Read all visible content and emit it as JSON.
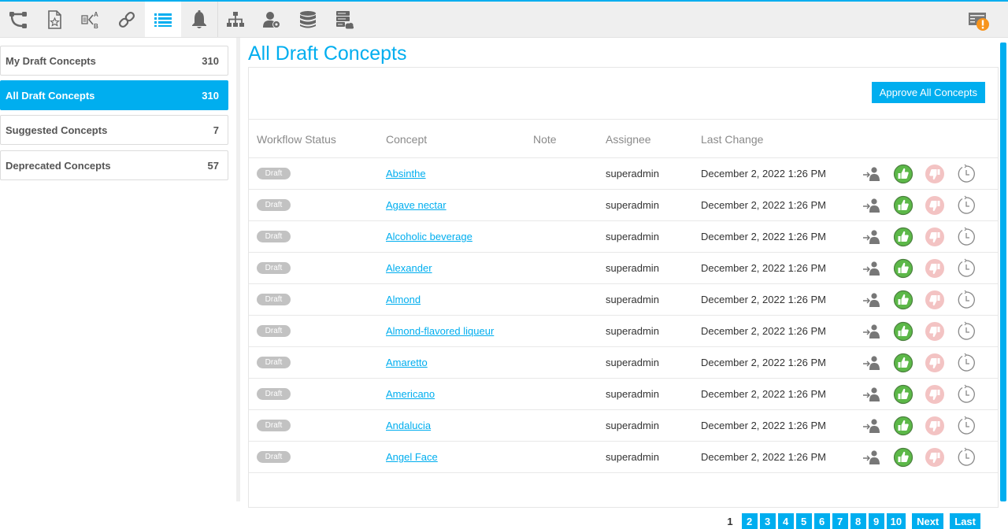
{
  "toolbar": {
    "tools": [
      {
        "name": "workflow-icon",
        "active": false
      },
      {
        "name": "favorite-document-icon",
        "active": false
      },
      {
        "name": "compare-ab-icon",
        "active": false
      },
      {
        "name": "link-icon",
        "active": false
      },
      {
        "name": "list-icon",
        "active": true
      },
      {
        "name": "bell-icon",
        "active": false
      },
      {
        "name": "hierarchy-icon",
        "active": false
      },
      {
        "name": "user-settings-icon",
        "active": false
      },
      {
        "name": "database-icon",
        "active": false
      },
      {
        "name": "server-cloud-icon",
        "active": false
      }
    ],
    "alert_icon": "task-alert-icon",
    "accent_color": "#00aeef",
    "alert_color": "#f7941d"
  },
  "sidebar": {
    "items": [
      {
        "label": "My Draft Concepts",
        "count": "310",
        "active": false
      },
      {
        "label": "All Draft Concepts",
        "count": "310",
        "active": true
      },
      {
        "label": "Suggested Concepts",
        "count": "7",
        "active": false
      },
      {
        "label": "Deprecated Concepts",
        "count": "57",
        "active": false
      }
    ]
  },
  "main": {
    "title": "All Draft Concepts",
    "approve_all_label": "Approve All Concepts",
    "columns": [
      "Workflow Status",
      "Concept",
      "Note",
      "Assignee",
      "Last Change"
    ],
    "rows": [
      {
        "status": "Draft",
        "concept": "Absinthe",
        "note": "",
        "assignee": "superadmin",
        "last_change": "December 2, 2022 1:26 PM"
      },
      {
        "status": "Draft",
        "concept": "Agave nectar",
        "note": "",
        "assignee": "superadmin",
        "last_change": "December 2, 2022 1:26 PM"
      },
      {
        "status": "Draft",
        "concept": "Alcoholic beverage",
        "note": "",
        "assignee": "superadmin",
        "last_change": "December 2, 2022 1:26 PM"
      },
      {
        "status": "Draft",
        "concept": "Alexander",
        "note": "",
        "assignee": "superadmin",
        "last_change": "December 2, 2022 1:26 PM"
      },
      {
        "status": "Draft",
        "concept": "Almond",
        "note": "",
        "assignee": "superadmin",
        "last_change": "December 2, 2022 1:26 PM"
      },
      {
        "status": "Draft",
        "concept": "Almond-flavored liqueur",
        "note": "",
        "assignee": "superadmin",
        "last_change": "December 2, 2022 1:26 PM"
      },
      {
        "status": "Draft",
        "concept": "Amaretto",
        "note": "",
        "assignee": "superadmin",
        "last_change": "December 2, 2022 1:26 PM"
      },
      {
        "status": "Draft",
        "concept": "Americano",
        "note": "",
        "assignee": "superadmin",
        "last_change": "December 2, 2022 1:26 PM"
      },
      {
        "status": "Draft",
        "concept": "Andalucia",
        "note": "",
        "assignee": "superadmin",
        "last_change": "December 2, 2022 1:26 PM"
      },
      {
        "status": "Draft",
        "concept": "Angel Face",
        "note": "",
        "assignee": "superadmin",
        "last_change": "December 2, 2022 1:26 PM"
      }
    ],
    "row_actions": [
      "assign-user-icon",
      "approve-thumbs-up-icon",
      "reject-thumbs-down-icon",
      "history-clock-icon"
    ],
    "pagination": {
      "current": "1",
      "pages": [
        "2",
        "3",
        "4",
        "5",
        "6",
        "7",
        "8",
        "9",
        "10"
      ],
      "next_label": "Next",
      "last_label": "Last"
    }
  }
}
